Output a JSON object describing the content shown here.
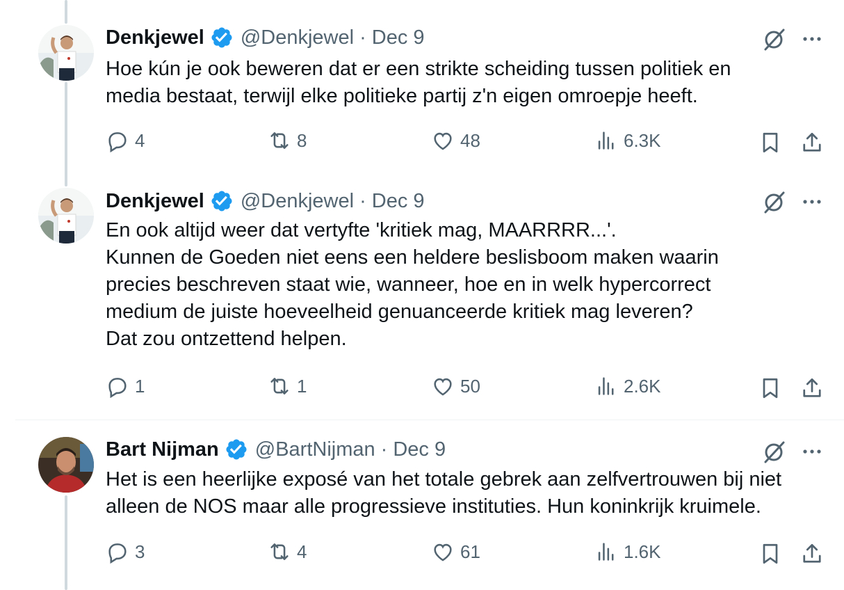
{
  "tweets": [
    {
      "name": "Denkjewel",
      "handle": "@Denkjewel",
      "dot": "·",
      "date": "Dec 9",
      "text": "Hoe kún je ook beweren dat er een strikte scheiding tussen politiek en\nmedia bestaat, terwijl elke politieke partij z'n eigen omroepje heeft.",
      "replies": "4",
      "reposts": "8",
      "likes": "48",
      "views": "6.3K"
    },
    {
      "name": "Denkjewel",
      "handle": "@Denkjewel",
      "dot": "·",
      "date": "Dec 9",
      "text": "En ook altijd weer dat vertyfte 'kritiek mag, MAARRRR...'.\nKunnen de Goeden niet eens een heldere beslisboom maken waarin\nprecies beschreven staat wie, wanneer, hoe en in welk hypercorrect\nmedium de juiste hoeveelheid genuanceerde kritiek mag leveren?\nDat zou ontzettend helpen.",
      "replies": "1",
      "reposts": "1",
      "likes": "50",
      "views": "2.6K"
    },
    {
      "name": "Bart Nijman",
      "handle": "@BartNijman",
      "dot": "·",
      "date": "Dec 9",
      "text": "Het is een heerlijke exposé van het totale gebrek aan zelfvertrouwen bij niet\nalleen de NOS maar alle progressieve instituties. Hun koninkrijk kruimele.",
      "replies": "3",
      "reposts": "4",
      "likes": "61",
      "views": "1.6K"
    }
  ],
  "icons": {
    "verified": "verified-badge-icon",
    "grok": "grok-icon",
    "more": "more-icon",
    "reply": "reply-icon",
    "repost": "repost-icon",
    "like": "like-icon",
    "views": "views-icon",
    "bookmark": "bookmark-icon",
    "share": "share-icon"
  },
  "colors": {
    "verified": "#1d9bf0",
    "text": "#0f1419",
    "secondary": "#536471",
    "thread_line": "#cfd9de"
  }
}
